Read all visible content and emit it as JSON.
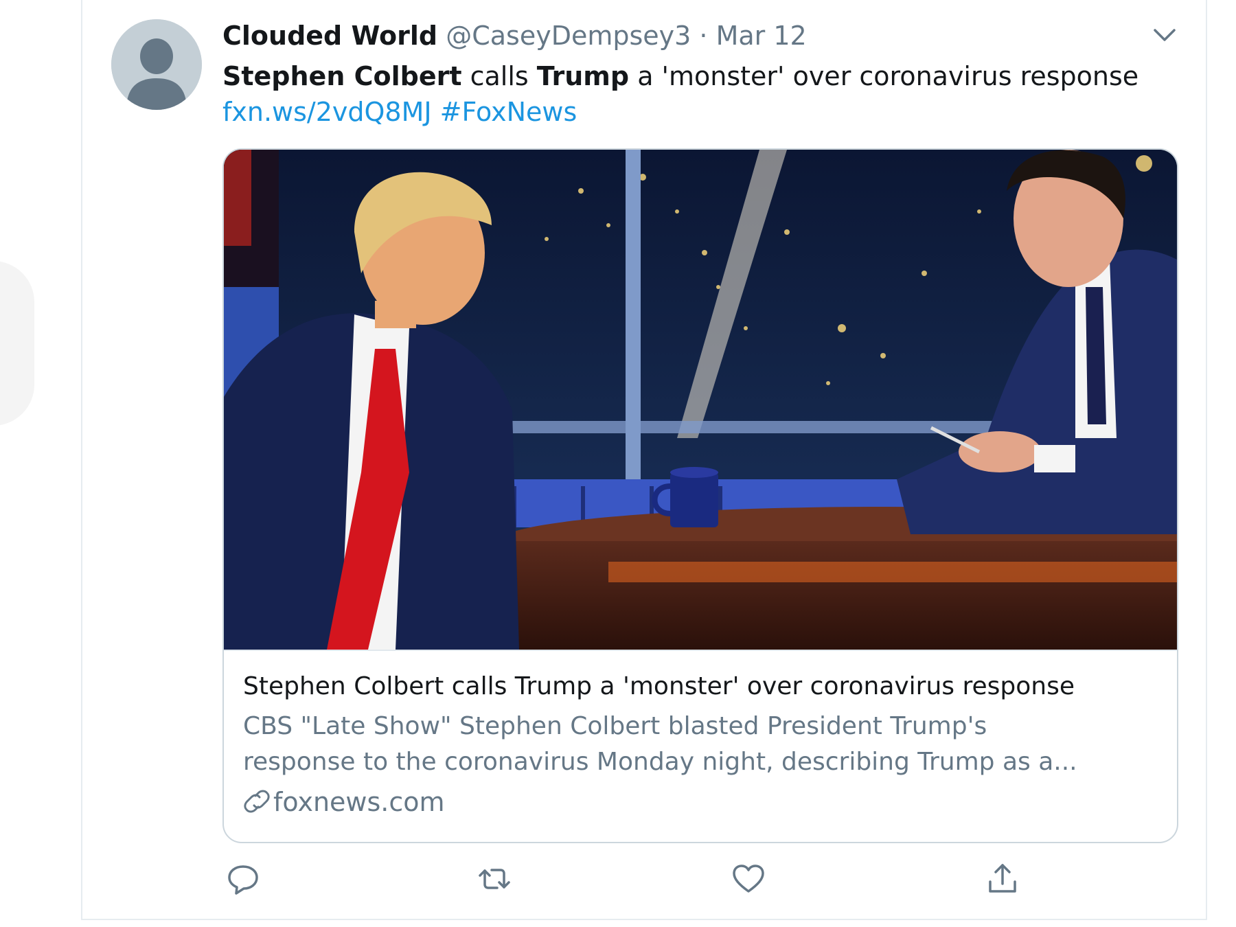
{
  "tweet": {
    "display_name": "Clouded World",
    "handle": "@CaseyDempsey3",
    "separator": "·",
    "date": "Mar 12",
    "text": {
      "part1": "Stephen Colbert",
      "part2": " calls ",
      "part3": "Trump",
      "part4": " a 'monster' over coronavirus response"
    },
    "link": "fxn.ws/2vdQ8MJ",
    "hashtag": "#FoxNews"
  },
  "card": {
    "title": "Stephen Colbert calls Trump a 'monster' over coronavirus response",
    "description_line1": "CBS \"Late Show\" Stephen Colbert blasted President Trump's",
    "description_line2": "response to the coronavirus Monday night, describing Trump as a...",
    "domain": "foxnews.com"
  },
  "icons": {
    "more": "chevron-down-icon",
    "reply": "reply-icon",
    "retweet": "retweet-icon",
    "like": "heart-icon",
    "share": "share-icon",
    "link": "link-icon"
  },
  "colors": {
    "text_primary": "#14171a",
    "text_secondary": "#657786",
    "link": "#1b95e0",
    "border": "#e6ecf0",
    "avatar_bg": "#c4cfd6"
  }
}
